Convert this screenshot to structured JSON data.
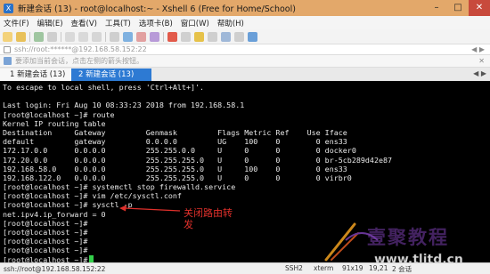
{
  "window": {
    "title": "新建会话 (13) - root@localhost:~ - Xshell 6 (Free for Home/School)"
  },
  "menu": [
    "文件(F)",
    "编辑(E)",
    "查看(V)",
    "工具(T)",
    "选项卡(B)",
    "窗口(W)",
    "帮助(H)"
  ],
  "address": {
    "value": "ssh://root:******@192.168.58.152:22"
  },
  "hint": {
    "text": "要添加当前会话，点击左侧的箭头按钮。"
  },
  "tabs": [
    {
      "label": "1 新建会话 (13)",
      "active": false
    },
    {
      "label": "2 新建会话 (13)",
      "active": true
    }
  ],
  "terminal": {
    "lines": [
      "To escape to local shell, press 'Ctrl+Alt+]'.",
      "",
      "Last login: Fri Aug 10 08:33:23 2018 from 192.168.58.1",
      "[root@localhost ~]# route",
      "Kernel IP routing table",
      "Destination     Gateway         Genmask         Flags Metric Ref    Use Iface",
      "default         gateway         0.0.0.0         UG    100    0        0 ens33",
      "172.17.0.0      0.0.0.0         255.255.0.0     U     0      0        0 docker0",
      "172.20.0.0      0.0.0.0         255.255.255.0   U     0      0        0 br-5cb289d42e87",
      "192.168.58.0    0.0.0.0         255.255.255.0   U     100    0        0 ens33",
      "192.168.122.0   0.0.0.0         255.255.255.0   U     0      0        0 virbr0",
      "[root@localhost ~]# systemctl stop firewalld.service",
      "[root@localhost ~]# vim /etc/sysctl.conf",
      "[root@localhost ~]# sysctl -p",
      "net.ipv4.ip_forward = 0",
      "[root@localhost ~]#",
      "[root@localhost ~]#",
      "[root@localhost ~]#",
      "[root@localhost ~]#",
      "[root@localhost ~]# "
    ],
    "annotation": "关闭路由转发"
  },
  "watermark": {
    "text": "壹聚教程",
    "site": "www.tlitd.cn"
  },
  "status": {
    "connection": "ssh://root@192.168.58.152:22",
    "protocol": "SSH2",
    "term": "xterm",
    "size": "91x19",
    "position": "19,21",
    "sessions": "2 会话"
  },
  "colors": {
    "accent": "#2d7ad3",
    "titlebar": "#e3a86a",
    "annotation": "#e0302b",
    "cursor": "#33d04a"
  }
}
